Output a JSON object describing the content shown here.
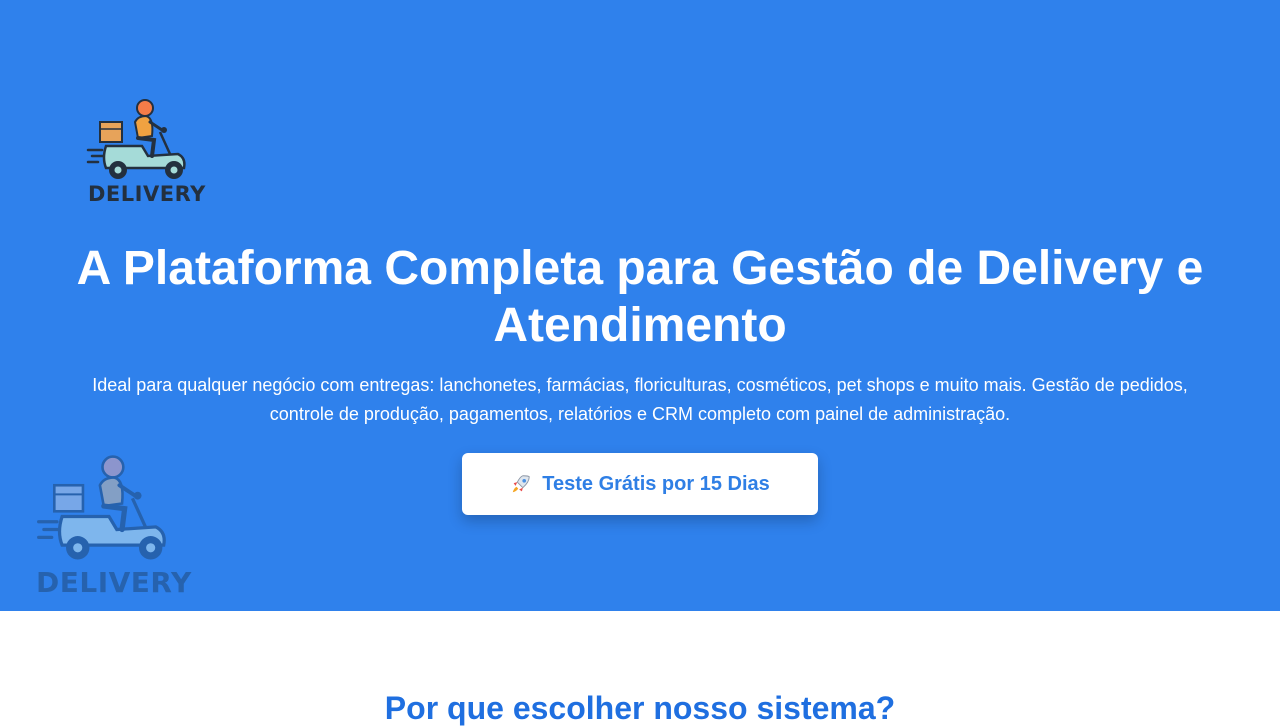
{
  "logo": {
    "word": "DELIVERY",
    "icon": "delivery-scooter-icon"
  },
  "hero": {
    "headline": "A Plataforma Completa para Gestão de Delivery e Atendimento",
    "subtitle": "Ideal para qualquer negócio com entregas: lanchonetes, farmácias, floriculturas, cosméticos, pet shops e muito mais. Gestão de pedidos, controle de produção, pagamentos, relatórios e CRM completo com painel de administração.",
    "cta_label": "Teste Grátis por 15 Dias",
    "cta_icon": "rocket-icon"
  },
  "features": {
    "title": "Por que escolher nosso sistema?"
  },
  "colors": {
    "hero_background": "#2f81ec",
    "cta_text": "#2f7fe5",
    "section_title": "#1f6fe0"
  }
}
